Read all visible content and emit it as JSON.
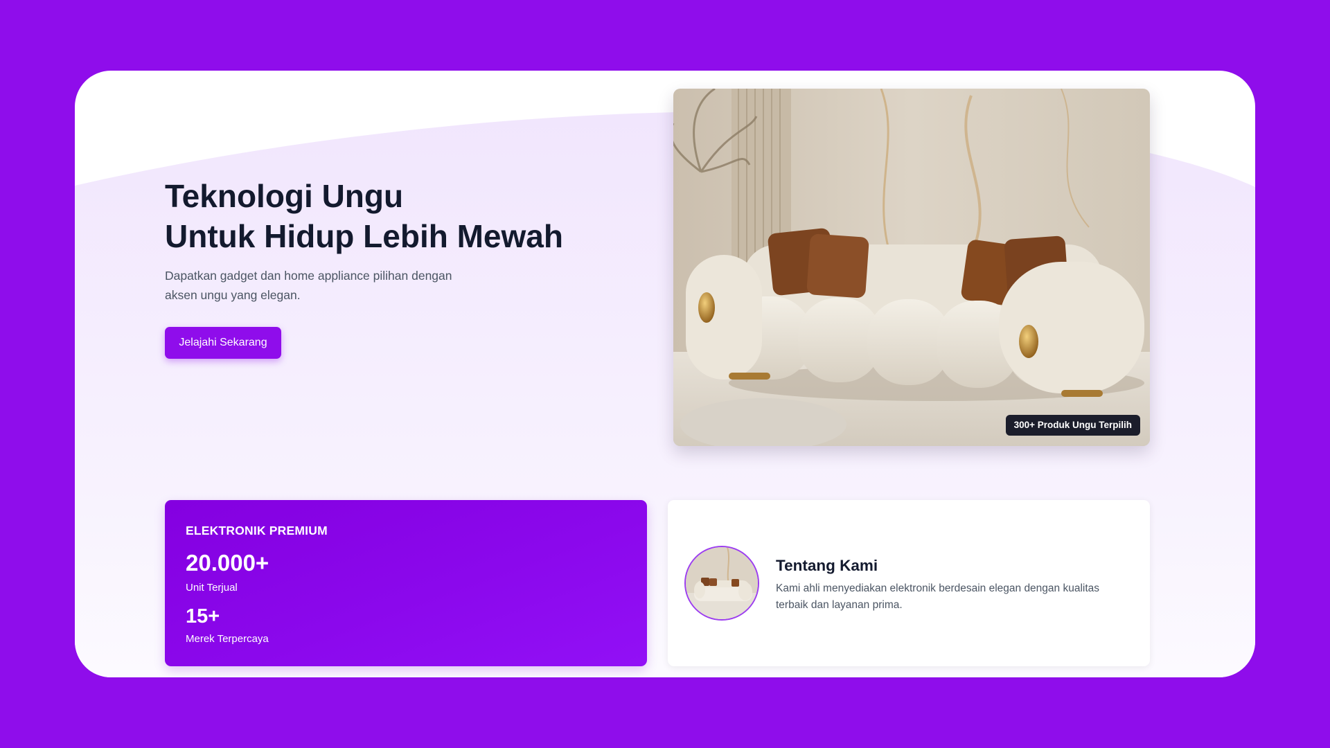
{
  "colors": {
    "page_background": "#8f0deb",
    "accent": "#8f0deb",
    "title_text": "#131a2e",
    "body_text": "#4b5563",
    "badge_background": "#1b1d2b"
  },
  "hero": {
    "title_line1": "Teknologi Ungu",
    "title_line2": "Untuk Hidup Lebih Mewah",
    "subtitle": "Dapatkan gadget dan home appliance pilihan dengan aksen ungu yang elegan.",
    "cta_label": "Jelajahi Sekarang",
    "image": {
      "subject": "cream-boucle-sofa-photo",
      "badge": "300+ Produk Ungu Terpilih"
    }
  },
  "stats_card": {
    "heading": "ELEKTRONIK PREMIUM",
    "stats": [
      {
        "value": "20.000+",
        "label": "Unit Terjual"
      },
      {
        "value": "15+",
        "label": "Merek Terpercaya"
      }
    ]
  },
  "about_card": {
    "image_subject": "sofa-thumbnail-photo",
    "title": "Tentang Kami",
    "description": "Kami ahli menyediakan elektronik berdesain elegan dengan kualitas terbaik dan layanan prima."
  }
}
